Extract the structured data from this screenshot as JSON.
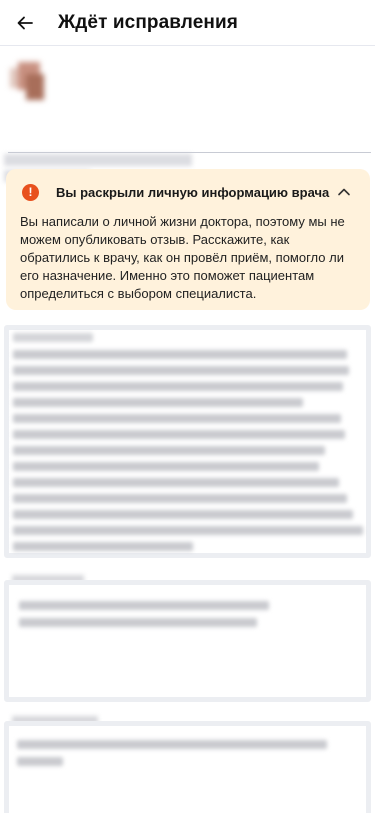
{
  "header": {
    "title": "Ждёт исправления",
    "back_icon": "arrow-left-icon"
  },
  "warning": {
    "icon": "exclamation-circle-icon",
    "title": "Вы раскрыли личную информацию врача",
    "body": "Вы написали о личной жизни доктора, поэтому мы не можем опубликовать отзыв. Расскажите, как обратились к врачу, как он провёл приём, помогло ли его назначение. Именно это поможет пациентам определиться с выбором специалиста.",
    "toggle_icon": "chevron-up-icon",
    "background": "#fff2dc",
    "accent": "#e8511e"
  }
}
